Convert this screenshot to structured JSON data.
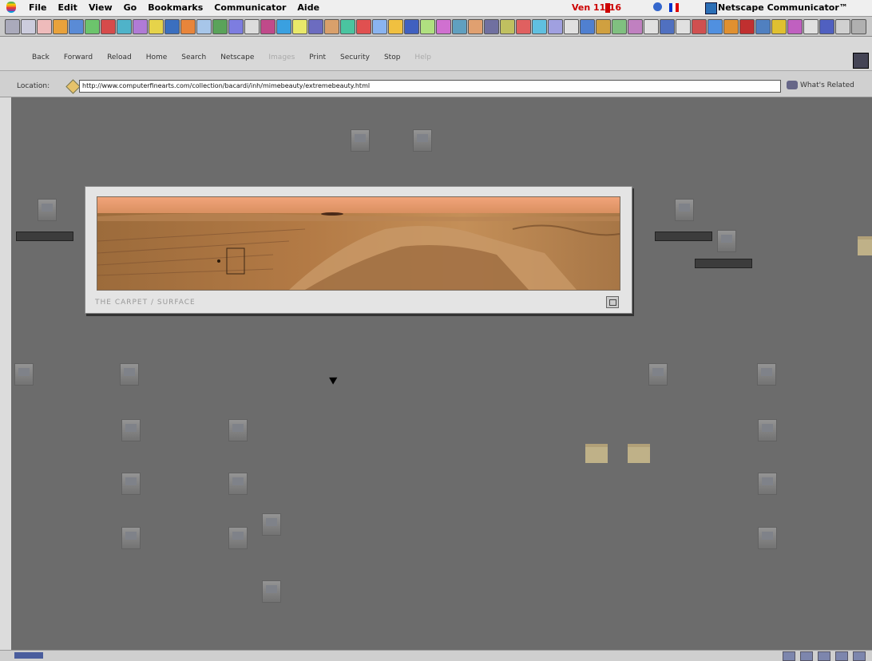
{
  "menubar": {
    "items": [
      "File",
      "Edit",
      "View",
      "Go",
      "Bookmarks",
      "Communicator",
      "Aide"
    ],
    "clock": "Ven 11:16",
    "app_name": "Netscape Communicator™"
  },
  "toolbar": {
    "buttons": [
      "Back",
      "Forward",
      "Reload",
      "Home",
      "Search",
      "Netscape",
      "Images",
      "Print",
      "Security",
      "Stop",
      "Help"
    ]
  },
  "location": {
    "label": "Location:",
    "url": "http://www.computerfinearts.com/collection/bacardi/inh/mimebeauty/extremebeauty.html",
    "related": "What's Related"
  },
  "panel": {
    "caption": "THE CARPET / SURFACE"
  },
  "colors": {
    "desktop": "#6c6c6c",
    "panel": "#e4e4e4"
  },
  "icons": {
    "desktop_items": "document-icon",
    "folders": "folder-icon"
  }
}
